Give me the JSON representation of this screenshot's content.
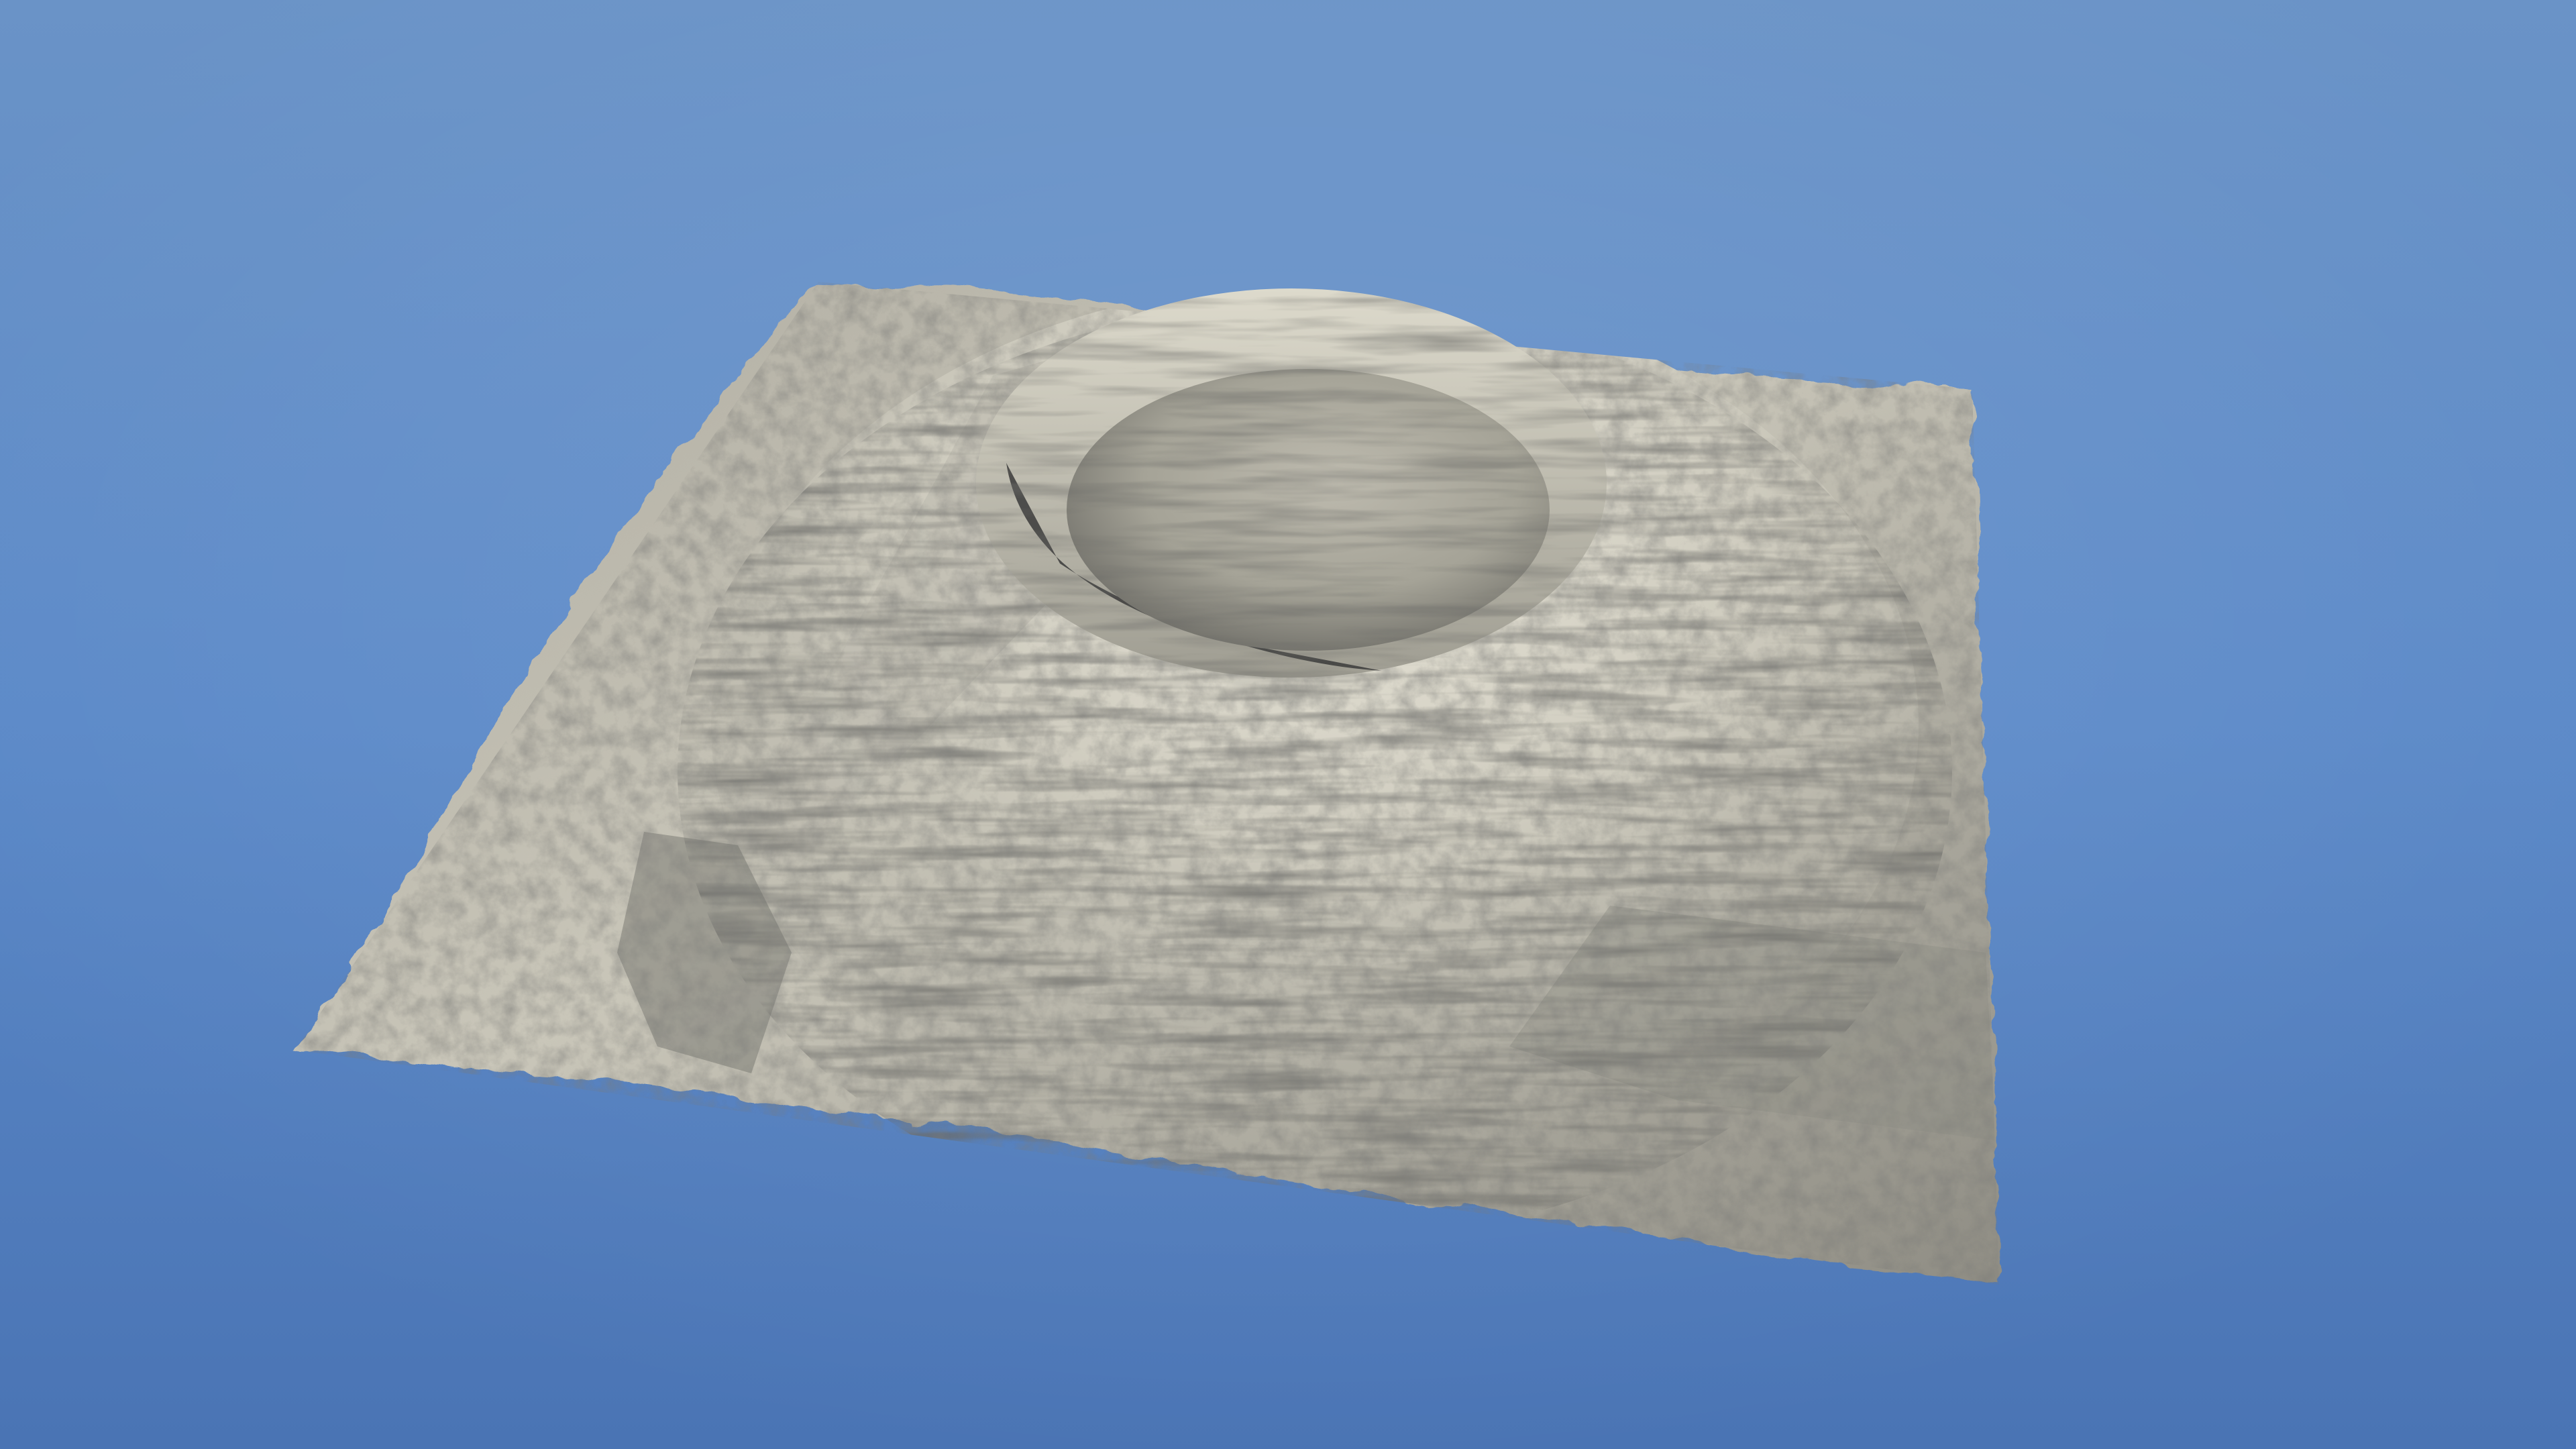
{
  "scene": {
    "subject": "crater-volcano-terrain",
    "colors": {
      "sky_top": "#6a93c7",
      "sky_mid": "#5b89c8",
      "sky_bottom": "#4a74b4",
      "terrain_light": "#d8d5c8",
      "terrain_mid": "#a9a79c",
      "terrain_dark": "#5a5a55",
      "crater_shadow": "#3a3a3a"
    }
  }
}
